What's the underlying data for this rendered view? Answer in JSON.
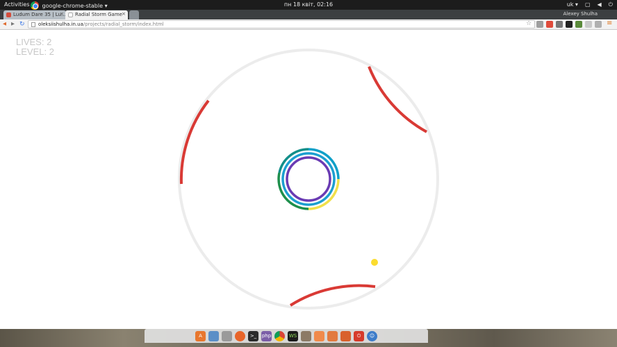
{
  "topbar": {
    "activities": "Activities",
    "app_menu": "google-chrome-stable ▾",
    "clock": "пн 18 квіт, 02:16",
    "keyboard_layout": "uk ▾",
    "tray_icons": [
      "network-icon",
      "volume-icon",
      "power-icon"
    ]
  },
  "tabs": [
    {
      "title": "Ludum Dare 35 | Lu…",
      "favicon_color": "#d44c3b",
      "active": false
    },
    {
      "title": "Radial Storm Game",
      "favicon_color": "#bbbbbb",
      "active": true
    }
  ],
  "profile_name": "Alexey Shulha",
  "toolbar": {
    "url_host": "oleksiishulha.in.ua",
    "url_path": "/projects/radial_storm/index.html"
  },
  "game": {
    "lives_text": "LIVES: 2",
    "level_text": "LEVEL: 2",
    "colors": {
      "hazard": "#d93a35",
      "boundary": "#ececec",
      "player": "#fbdc2f",
      "core_rings": [
        "#0fa0c8",
        "#6a3bb3",
        "#1e8f4c",
        "#8dc63f",
        "#f1e04a"
      ]
    },
    "player_label": "player-dot"
  },
  "dock": {
    "items": [
      "software-icon",
      "screenshot-icon",
      "calculator-icon",
      "firefox-icon",
      "terminal-icon",
      "phpstorm-icon",
      "chrome-icon",
      "webstorm-icon",
      "files-icon",
      "folder-icon",
      "photos-icon",
      "shotwell-icon",
      "power-icon",
      "accessibility-icon"
    ]
  }
}
